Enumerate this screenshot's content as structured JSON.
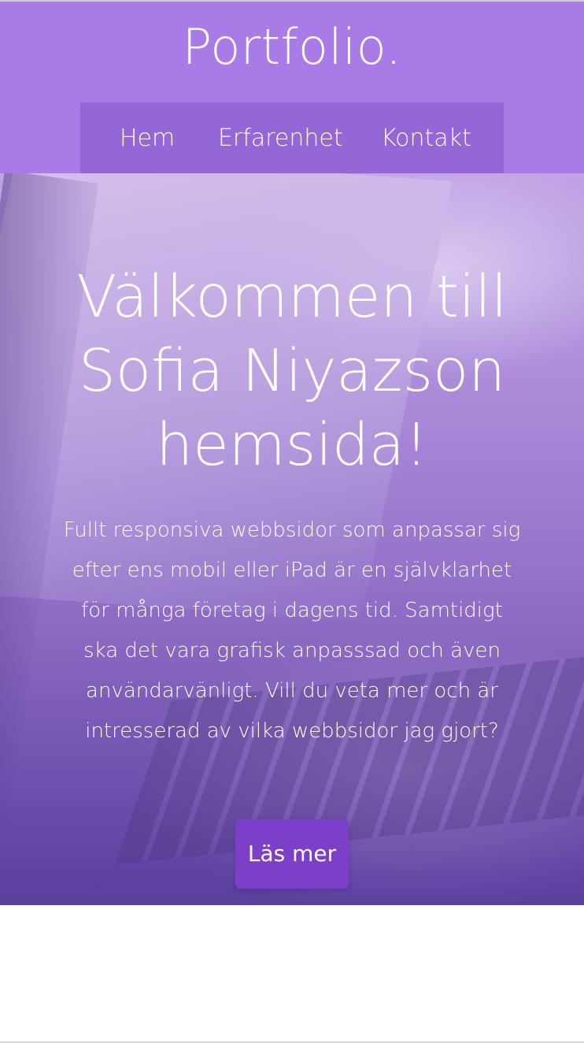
{
  "header": {
    "logo": "Portfolio.",
    "nav": [
      {
        "label": "Hem"
      },
      {
        "label": "Erfarenhet"
      },
      {
        "label": "Kontakt"
      }
    ]
  },
  "hero": {
    "title": "Välkommen till Sofia Niyazson hemsida!",
    "text": "Fullt responsiva webbsidor som anpassar sig efter ens mobil eller iPad är en självklarhet för många företag i dagens tid. Samtidigt ska det vara grafisk anpasssad och även användarvänligt. Vill du veta mer och är intresserad av vilka webbsidor jag gjort?",
    "button_label": "Läs mer"
  },
  "colors": {
    "header_bg": "#a97be6",
    "nav_bg": "#9566d6",
    "button_bg": "#7c3fc8"
  }
}
